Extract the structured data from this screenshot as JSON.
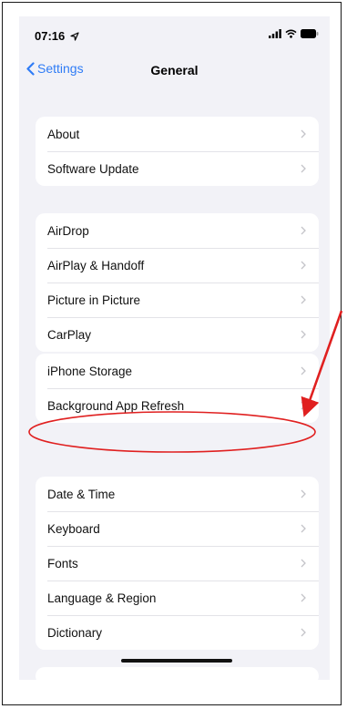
{
  "status_bar": {
    "time": "07:16"
  },
  "nav": {
    "back_label": "Settings",
    "title": "General"
  },
  "groups": [
    {
      "items": [
        {
          "label": "About"
        },
        {
          "label": "Software Update"
        }
      ]
    },
    {
      "items": [
        {
          "label": "AirDrop"
        },
        {
          "label": "AirPlay & Handoff"
        },
        {
          "label": "Picture in Picture"
        },
        {
          "label": "CarPlay"
        }
      ]
    },
    {
      "items": [
        {
          "label": "iPhone Storage"
        },
        {
          "label": "Background App Refresh"
        }
      ]
    },
    {
      "items": [
        {
          "label": "Date & Time"
        },
        {
          "label": "Keyboard"
        },
        {
          "label": "Fonts"
        },
        {
          "label": "Language & Region"
        },
        {
          "label": "Dictionary"
        }
      ]
    }
  ],
  "colors": {
    "accent": "#2f7cf6",
    "annotation": "#e02020",
    "background": "#f2f2f7"
  },
  "icons": [
    "location-arrow-icon",
    "cellular-signal-icon",
    "wifi-icon",
    "battery-icon",
    "back-chevron-icon",
    "chevron-right-icon"
  ]
}
